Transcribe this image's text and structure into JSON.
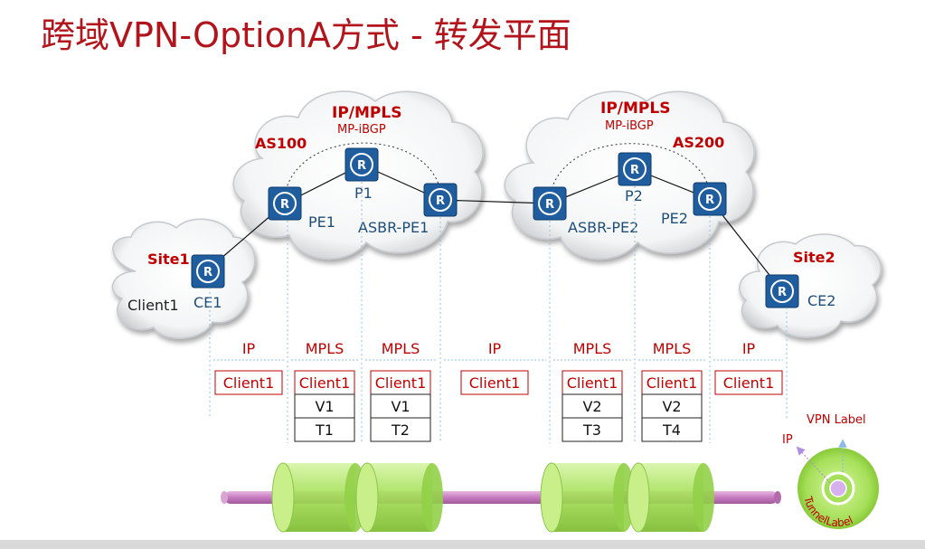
{
  "title": "跨域VPN-OptionA方式 - 转发平面",
  "clouds": {
    "as100_core": "IP/MPLS",
    "as100_proto": "MP-iBGP",
    "as100_label": "AS100",
    "as200_core": "IP/MPLS",
    "as200_proto": "MP-iBGP",
    "as200_label": "AS200",
    "site1_label": "Site1",
    "site2_label": "Site2"
  },
  "devices": {
    "ce1": "CE1",
    "pe1": "PE1",
    "p1": "P1",
    "asbr_pe1": "ASBR-PE1",
    "asbr_pe2": "ASBR-PE2",
    "p2": "P2",
    "pe2": "PE2",
    "ce2": "CE2",
    "client1": "Client1"
  },
  "segments": [
    "IP",
    "MPLS",
    "MPLS",
    "IP",
    "MPLS",
    "MPLS",
    "IP"
  ],
  "packets": [
    [
      "Client1"
    ],
    [
      "Client1",
      "V1",
      "T1"
    ],
    [
      "Client1",
      "V1",
      "T2"
    ],
    [
      "Client1"
    ],
    [
      "Client1",
      "V2",
      "T3"
    ],
    [
      "Client1",
      "V2",
      "T4"
    ],
    [
      "Client1"
    ]
  ],
  "legend": {
    "vpn_label": "VPN Label",
    "ip": "IP",
    "tunnel_label": "TunnelLabel"
  },
  "colors": {
    "title": "#b3141c",
    "label_red": "#c00000",
    "device_blue": "#1f5d9e",
    "text_blue": "#1f4e79",
    "pipe_pink": "#c77bc0",
    "tunnel_green": "#a6e05a",
    "dotted_blue": "#8fc3e6"
  }
}
